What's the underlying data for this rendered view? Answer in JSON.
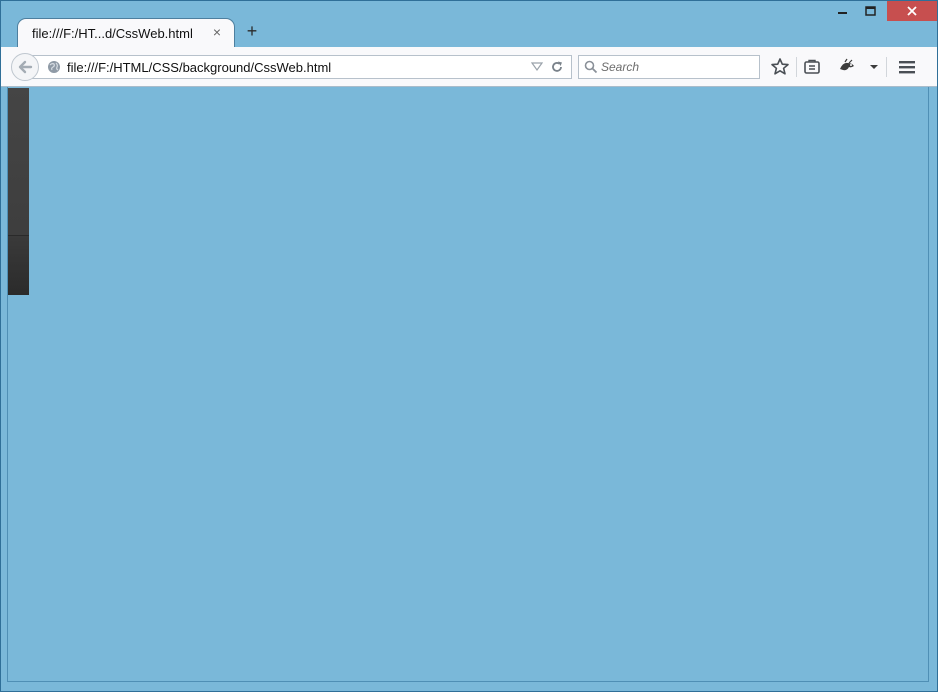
{
  "window": {
    "controls": {
      "minimize": "–",
      "maximize": "□",
      "close": "✕"
    }
  },
  "tabs": [
    {
      "title": "file:///F:/HT...d/CssWeb.html",
      "close_glyph": "×",
      "active": true
    }
  ],
  "new_tab_glyph": "+",
  "toolbar": {
    "url": "file:///F:/HTML/CSS/background/CssWeb.html",
    "search_placeholder": "Search",
    "icons": [
      "back-icon",
      "globe-icon",
      "dropdown-icon",
      "reload-icon",
      "search-icon",
      "bookmark-star-icon",
      "reading-list-icon",
      "addon-icon",
      "chevron-down-icon",
      "menu-icon"
    ]
  },
  "colors": {
    "page_background": "#7ab8d9",
    "close_button": "#c74f4f",
    "sidebar_strip": "#3b3b3b"
  }
}
